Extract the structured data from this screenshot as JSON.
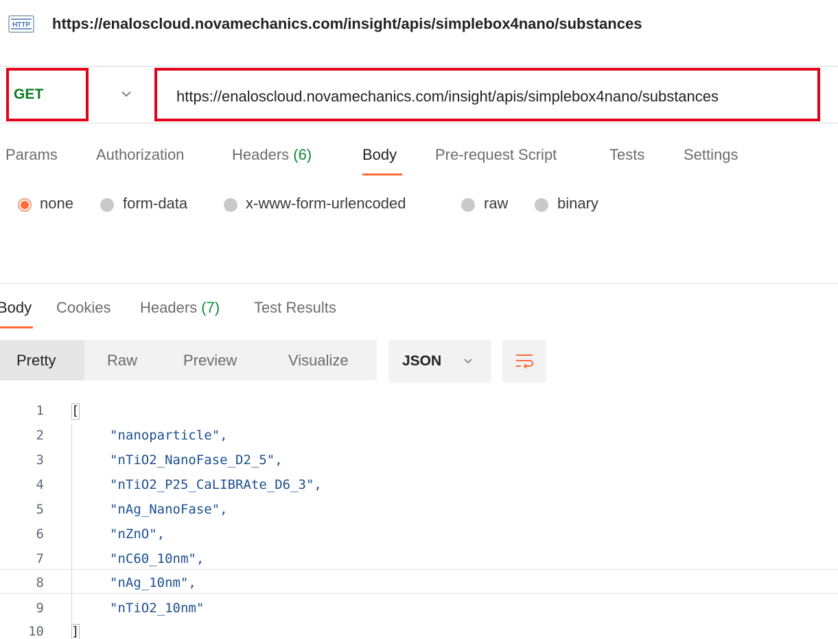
{
  "title_row": {
    "icon": "http-icon",
    "url": "https://enaloscloud.novamechanics.com/insight/apis/simplebox4nano/substances"
  },
  "request": {
    "method": "GET",
    "url": "https://enaloscloud.novamechanics.com/insight/apis/simplebox4nano/substances",
    "highlight_color": "#e3001b"
  },
  "request_tabs": [
    {
      "label": "Params"
    },
    {
      "label": "Authorization"
    },
    {
      "label": "Headers",
      "count": "(6)"
    },
    {
      "label": "Body",
      "active": true
    },
    {
      "label": "Pre-request Script"
    },
    {
      "label": "Tests"
    },
    {
      "label": "Settings"
    }
  ],
  "body_types": [
    {
      "label": "none",
      "selected": true
    },
    {
      "label": "form-data"
    },
    {
      "label": "x-www-form-urlencoded"
    },
    {
      "label": "raw"
    },
    {
      "label": "binary"
    }
  ],
  "response_tabs": [
    {
      "label": "Body",
      "active": true
    },
    {
      "label": "Cookies"
    },
    {
      "label": "Headers",
      "count": "(7)"
    },
    {
      "label": "Test Results"
    }
  ],
  "view_modes": [
    {
      "label": "Pretty",
      "active": true
    },
    {
      "label": "Raw"
    },
    {
      "label": "Preview"
    },
    {
      "label": "Visualize"
    }
  ],
  "format": "JSON",
  "code_lines": [
    {
      "n": "1",
      "text": "["
    },
    {
      "n": "2",
      "text": "\"nanoparticle\","
    },
    {
      "n": "3",
      "text": "\"nTiO2_NanoFase_D2_5\","
    },
    {
      "n": "4",
      "text": "\"nTiO2_P25_CaLIBRAte_D6_3\","
    },
    {
      "n": "5",
      "text": "\"nAg_NanoFase\","
    },
    {
      "n": "6",
      "text": "\"nZnO\","
    },
    {
      "n": "7",
      "text": "\"nC60_10nm\","
    },
    {
      "n": "8",
      "text": "\"nAg_10nm\","
    },
    {
      "n": "9",
      "text": "\"nTiO2_10nm\""
    },
    {
      "n": "10",
      "text": "]"
    }
  ],
  "colors": {
    "accent": "#ff6c37",
    "count_green": "#0b8a3a",
    "method_green": "#0b7a1e",
    "string_blue": "#1c4f8e"
  }
}
